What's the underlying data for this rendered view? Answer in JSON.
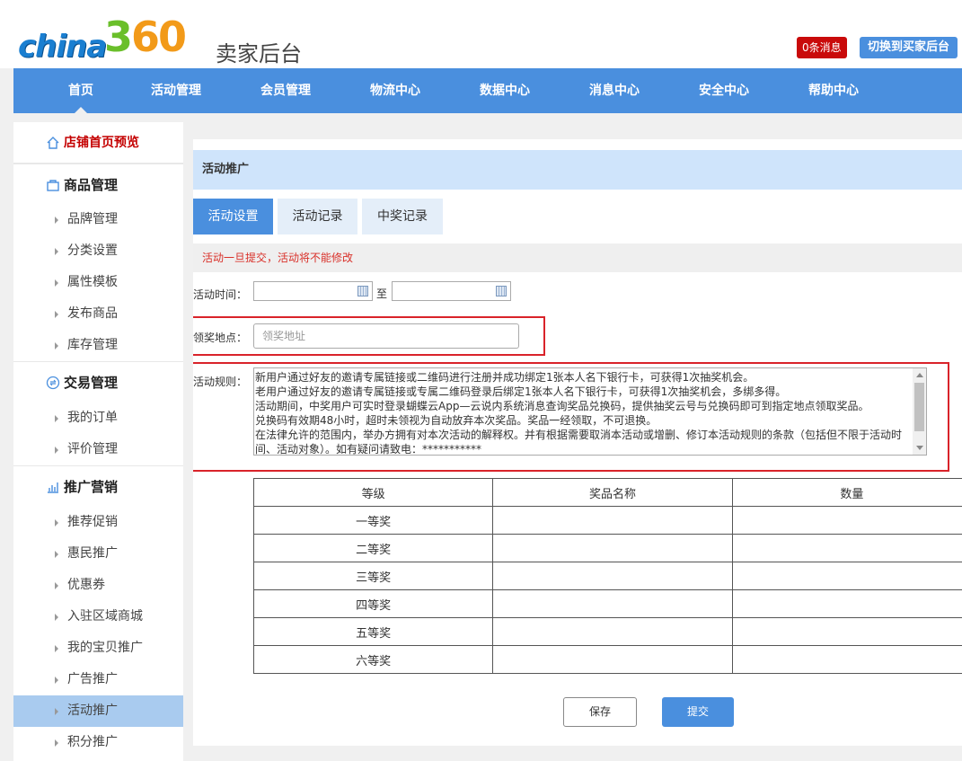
{
  "header": {
    "logo_text_china": "china",
    "logo_text_num": "360",
    "site_title": "卖家后台",
    "messages_badge": "0条消息",
    "switch_button": "切换到买家后台"
  },
  "nav": {
    "items": [
      {
        "label": "首页",
        "active": true
      },
      {
        "label": "活动管理"
      },
      {
        "label": "会员管理"
      },
      {
        "label": "物流中心"
      },
      {
        "label": "数据中心"
      },
      {
        "label": "消息中心"
      },
      {
        "label": "安全中心"
      },
      {
        "label": "帮助中心"
      }
    ]
  },
  "sidebar": {
    "preview": "店铺首页预览",
    "groups": [
      {
        "title": "商品管理",
        "icon": "bag-icon",
        "items": [
          "品牌管理",
          "分类设置",
          "属性模板",
          "发布商品",
          "库存管理"
        ]
      },
      {
        "title": "交易管理",
        "icon": "exchange-icon",
        "items": [
          "我的订单",
          "评价管理"
        ]
      },
      {
        "title": "推广营销",
        "icon": "bar-chart-icon",
        "items": [
          "推荐促销",
          "惠民推广",
          "优惠券",
          "入驻区域商城",
          "我的宝贝推广",
          "广告推广",
          "活动推广",
          "积分推广"
        ]
      }
    ],
    "active_item": "活动推广"
  },
  "main": {
    "title": "活动推广",
    "tabs": [
      {
        "label": "活动设置",
        "active": true
      },
      {
        "label": "活动记录"
      },
      {
        "label": "中奖记录"
      }
    ],
    "warning": "活动一旦提交，活动将不能修改",
    "time_label": "活动时间：",
    "time_to": "至",
    "address_label": "领奖地点：",
    "address_placeholder": "领奖地址",
    "rules_label": "活动规则：",
    "rules_text": "新用户通过好友的邀请专属链接或二维码进行注册并成功绑定1张本人名下银行卡，可获得1次抽奖机会。\n老用户通过好友的邀请专属链接或专属二维码登录后绑定1张本人名下银行卡，可获得1次抽奖机会，多绑多得。\n活动期间，中奖用户可实时登录蝴蝶云App—云说内系统消息查询奖品兑换码，提供抽奖云号与兑换码即可到指定地点领取奖品。\n兑换码有效期48小时，超时未领视为自动放弃本次奖品。奖品一经领取，不可退换。\n在法律允许的范围内，举办方拥有对本次活动的解释权。并有根据需要取消本活动或增删、修订本活动规则的条款（包括但不限于活动时间、活动对象）。如有疑问请致电：***********",
    "table": {
      "headers": [
        "等级",
        "奖品名称",
        "数量"
      ],
      "rows": [
        "一等奖",
        "二等奖",
        "三等奖",
        "四等奖",
        "五等奖",
        "六等奖"
      ]
    },
    "save_button": "保存",
    "submit_button": "提交"
  },
  "colors": {
    "primary": "#4a8fde",
    "highlight_red": "#d9232a",
    "active_sidebar": "#a9cbef"
  }
}
